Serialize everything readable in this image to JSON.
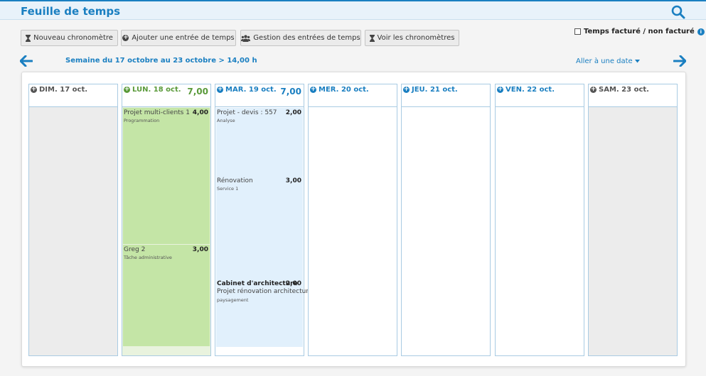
{
  "header": {
    "title": "Feuille de temps",
    "search_icon": "search-icon"
  },
  "colors": {
    "accent": "#1a7fc1",
    "green": "#5a9a3a",
    "entry_green": "#c4e5a6",
    "entry_blue": "#e1f0fc",
    "weekend": "#ececec"
  },
  "toolbar": {
    "new_timer": "Nouveau chronomètre",
    "add_entry": "Ajouter une entrée de temps",
    "manage_entries": "Gestion des entrées de temps",
    "view_timers": "Voir les chronomètres"
  },
  "billed_toggle": {
    "label": "Temps facturé / non facturé",
    "checked": false
  },
  "nav": {
    "week_label": "Semaine du 17 octobre au 23 octobre > 14,00 h",
    "goto_label": "Aller à une date"
  },
  "days": [
    {
      "label": "DIM. 17 oct.",
      "total": ""
    },
    {
      "label": "LUN. 18 oct.",
      "total": "7,00"
    },
    {
      "label": "MAR. 19 oct.",
      "total": "7,00"
    },
    {
      "label": "MER. 20 oct.",
      "total": ""
    },
    {
      "label": "JEU. 21 oct.",
      "total": ""
    },
    {
      "label": "VEN. 22 oct.",
      "total": ""
    },
    {
      "label": "SAM. 23 oct.",
      "total": ""
    }
  ],
  "entries": {
    "mon": [
      {
        "project": "Projet multi-clients 1",
        "task": "Programmation",
        "hours": "4,00"
      },
      {
        "project": "Greg 2",
        "task": "Tâche administrative",
        "hours": "3,00"
      }
    ],
    "tue": [
      {
        "project": "Projet - devis : 557",
        "task": "Analyse",
        "hours": "2,00"
      },
      {
        "project": "Rénovation",
        "task": "Service 1",
        "hours": "3,00"
      },
      {
        "client": "Cabinet d'architecture",
        "project": "Projet rénovation architecture",
        "task": "paysagement",
        "hours": "2,00"
      }
    ]
  }
}
